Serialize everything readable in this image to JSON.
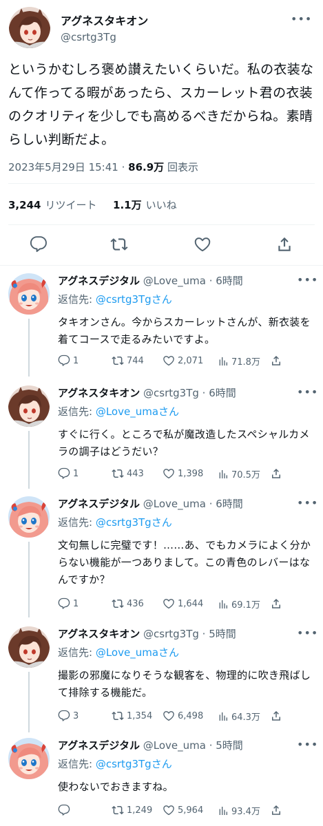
{
  "main_tweet": {
    "author_name": "アグネスタキオン",
    "author_handle": "@csrtg3Tg",
    "text": "というかむしろ褒め讃えたいくらいだ。私の衣装なんて作ってる暇があったら、スカーレット君の衣装のクオリティを少しでも高めるべきだからね。素晴らしい判断だよ。",
    "timestamp": "2023年5月29日 15:41",
    "views_count": "86.9万",
    "views_label": "回表示",
    "retweet_count": "3,244",
    "retweet_label": "リツイート",
    "like_count": "1.1万",
    "like_label": "いいね",
    "more_glyph": "•••"
  },
  "replies": [
    {
      "name": "アグネスデジタル",
      "handle": "@Love_uma",
      "time": "6時間",
      "reply_prefix": "返信先: ",
      "reply_to": "@csrtg3Tgさん",
      "text": "タキオンさん。今からスカーレットさんが、新衣装を着てコースで走るみたいですよ。",
      "replies": "1",
      "retweets": "744",
      "likes": "2,071",
      "views": "71.8万"
    },
    {
      "name": "アグネスタキオン",
      "handle": "@csrtg3Tg",
      "time": "6時間",
      "reply_prefix": "返信先: ",
      "reply_to": "@Love_umaさん",
      "text": "すぐに行く。ところで私が魔改造したスペシャルカメラの調子はどうだい？",
      "replies": "1",
      "retweets": "443",
      "likes": "1,398",
      "views": "70.5万"
    },
    {
      "name": "アグネスデジタル",
      "handle": "@Love_uma",
      "time": "6時間",
      "reply_prefix": "返信先: ",
      "reply_to": "@csrtg3Tgさん",
      "text": "文句無しに完璧です！……あ、でもカメラによく分からない機能が一つありまして。この青色のレバーはなんですか？",
      "replies": "1",
      "retweets": "436",
      "likes": "1,644",
      "views": "69.1万"
    },
    {
      "name": "アグネスタキオン",
      "handle": "@csrtg3Tg",
      "time": "5時間",
      "reply_prefix": "返信先: ",
      "reply_to": "@Love_umaさん",
      "text": "撮影の邪魔になりそうな観客を、物理的に吹き飛ばして排除する機能だ。",
      "replies": "3",
      "retweets": "1,354",
      "likes": "6,498",
      "views": "64.3万"
    },
    {
      "name": "アグネスデジタル",
      "handle": "@Love_uma",
      "time": "5時間",
      "reply_prefix": "返信先: ",
      "reply_to": "@csrtg3Tgさん",
      "text": "使わないでおきますね。",
      "replies": "",
      "retweets": "1,249",
      "likes": "5,964",
      "views": "93.4万"
    }
  ],
  "icons": {
    "reply": "reply-icon",
    "retweet": "retweet-icon",
    "like": "heart-icon",
    "share": "share-icon",
    "views": "views-chart-icon",
    "more": "more-icon"
  },
  "colors": {
    "link": "#1d9bf0",
    "secondary": "#536471",
    "text": "#0f1419",
    "divider": "#eff3f4",
    "thread_line": "#cfd9de",
    "takion_hair": "#6b3a2a",
    "digital_hair": "#f29a8e"
  }
}
